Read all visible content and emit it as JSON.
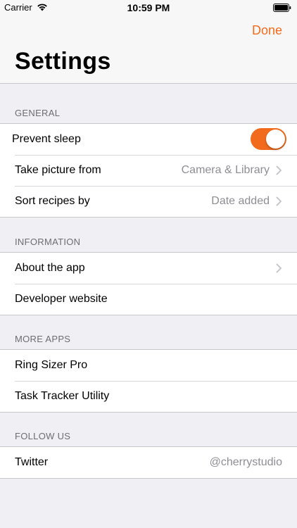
{
  "status_bar": {
    "carrier": "Carrier",
    "time": "10:59 PM"
  },
  "nav": {
    "done_label": "Done",
    "title": "Settings"
  },
  "accent_color": "#f26b1d",
  "sections": {
    "general": {
      "header": "GENERAL",
      "prevent_sleep": {
        "label": "Prevent sleep",
        "toggle_on": true
      },
      "take_picture": {
        "label": "Take picture from",
        "value": "Camera & Library"
      },
      "sort_recipes": {
        "label": "Sort recipes by",
        "value": "Date added"
      }
    },
    "information": {
      "header": "INFORMATION",
      "about": {
        "label": "About the app"
      },
      "developer": {
        "label": "Developer website"
      }
    },
    "more_apps": {
      "header": "MORE APPS",
      "ring_sizer": {
        "label": "Ring Sizer Pro"
      },
      "task_tracker": {
        "label": "Task Tracker Utility"
      }
    },
    "follow_us": {
      "header": "FOLLOW US",
      "twitter": {
        "label": "Twitter",
        "value": "@cherrystudio"
      }
    }
  },
  "icons": {
    "wifi": "wifi-icon",
    "battery": "battery-icon",
    "chevron": "chevron-right-icon"
  }
}
